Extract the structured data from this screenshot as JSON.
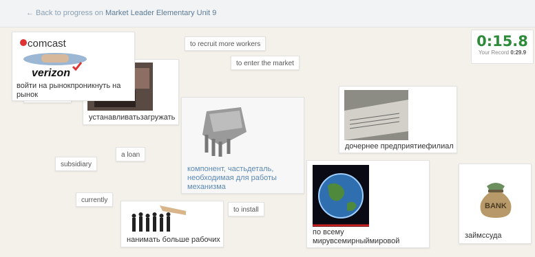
{
  "topbar": {
    "back_text": "← Back to progress on",
    "unit_title": "Market Leader Elementary Unit 9"
  },
  "timer": {
    "time": "0:15.8",
    "record_label": "Your Record",
    "record_value": "0:29.9"
  },
  "terms": {
    "recruit": "to recruit more workers",
    "enter_market": "to enter the market",
    "loan": "a loan",
    "subsidiary": "subsidiary",
    "currently": "currently",
    "install": "to install"
  },
  "cards": {
    "market": {
      "caption": "войти на рынокпроникнуть на рынок",
      "logo_top": "comcast",
      "logo_bottom": "verizon"
    },
    "install": {
      "caption": "устанавливатьзагружать"
    },
    "component": {
      "caption": "компонент, частьдеталь, необходимая для работы механизма"
    },
    "subsidiary": {
      "caption": "дочернее предприятиефилиал"
    },
    "globe": {
      "caption": "по всему мирувсемирныймировой"
    },
    "workers": {
      "caption": "нанимать больше рабочих"
    },
    "loan": {
      "caption": "займссуда",
      "bag_label": "BANK"
    }
  },
  "colors": {
    "timer_green": "#2e8b3c",
    "link_blue": "#5c7a96",
    "board_bg": "#f4f1ea"
  }
}
